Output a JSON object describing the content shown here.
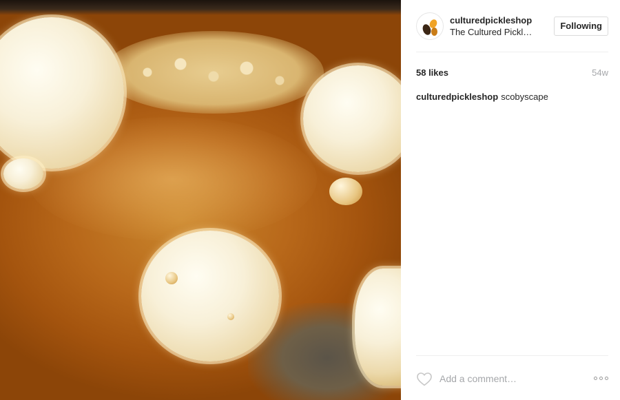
{
  "post": {
    "image_description_icon": "scoby-photo",
    "username": "culturedpickleshop",
    "location": "The Cultured Pickl…",
    "follow_label": "Following",
    "likes": "58 likes",
    "age": "54w",
    "caption": {
      "username": "culturedpickleshop",
      "text": "scobyscape"
    }
  },
  "comment_bar": {
    "like_icon": "heart-outline-icon",
    "placeholder": "Add a comment…",
    "more_icon": "more-options-icon"
  },
  "colors": {
    "text": "#262626",
    "muted": "#a5a7aa",
    "border": "#dbdbdb"
  }
}
